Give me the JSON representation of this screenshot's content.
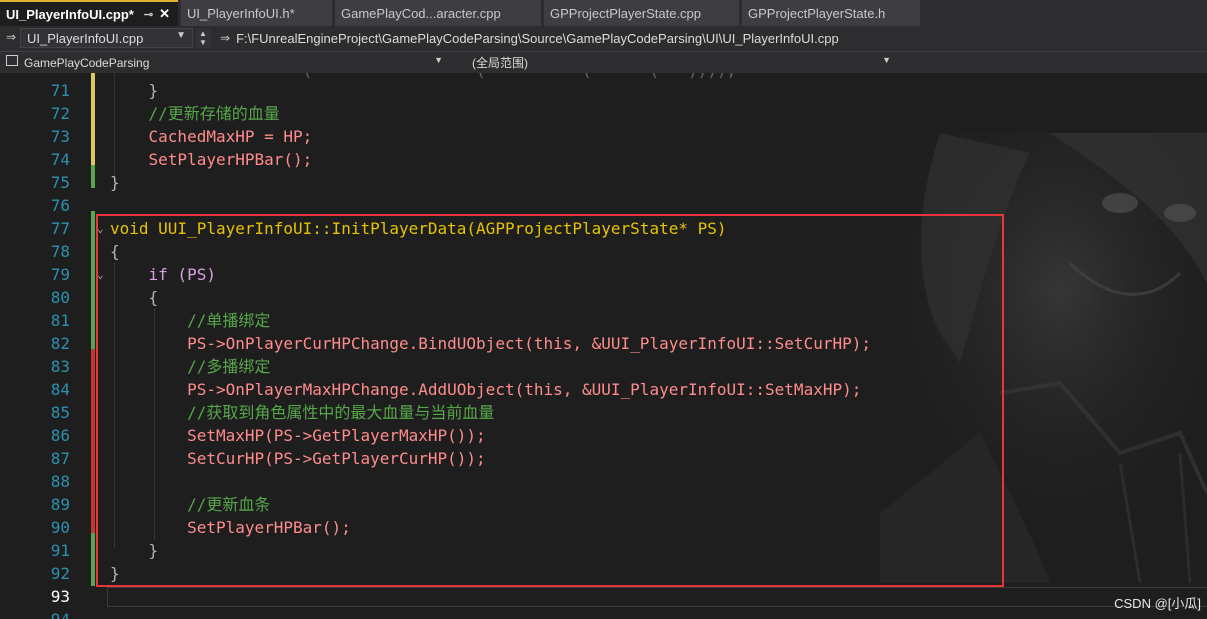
{
  "tabs": [
    {
      "label": "UI_PlayerInfoUI.cpp*",
      "active": true,
      "pin": "⊸",
      "close": "✕"
    },
    {
      "label": "UI_PlayerInfoUI.h*"
    },
    {
      "label": "GamePlayCod...aracter.cpp"
    },
    {
      "label": "GPProjectPlayerState.cpp"
    },
    {
      "label": "GPProjectPlayerState.h"
    }
  ],
  "nav": {
    "file_combo": "UI_PlayerInfoUI.cpp",
    "path": "F:\\FUnrealEngineProject\\GamePlayCodeParsing\\Source\\GamePlayCodeParsing\\UI\\UI_PlayerInfoUI.cpp",
    "project_combo": "GamePlayCodeParsing",
    "scope_combo": "(全局范围)"
  },
  "code_lines": [
    {
      "n": "71",
      "text": "    }"
    },
    {
      "n": "72",
      "text": "    //更新存储的血量"
    },
    {
      "n": "73",
      "text": "    CachedMaxHP = HP;"
    },
    {
      "n": "74",
      "text": "    SetPlayerHPBar();"
    },
    {
      "n": "75",
      "text": "}"
    },
    {
      "n": "76",
      "text": ""
    },
    {
      "n": "77",
      "text": "void UUI_PlayerInfoUI::InitPlayerData(AGPProjectPlayerState* PS)"
    },
    {
      "n": "78",
      "text": "{"
    },
    {
      "n": "79",
      "text": "    if (PS)"
    },
    {
      "n": "80",
      "text": "    {"
    },
    {
      "n": "81",
      "text": "        //单播绑定"
    },
    {
      "n": "82",
      "text": "        PS->OnPlayerCurHPChange.BindUObject(this, &UUI_PlayerInfoUI::SetCurHP);"
    },
    {
      "n": "83",
      "text": "        //多播绑定"
    },
    {
      "n": "84",
      "text": "        PS->OnPlayerMaxHPChange.AddUObject(this, &UUI_PlayerInfoUI::SetMaxHP);"
    },
    {
      "n": "85",
      "text": "        //获取到角色属性中的最大血量与当前血量"
    },
    {
      "n": "86",
      "text": "        SetMaxHP(PS->GetPlayerMaxHP());"
    },
    {
      "n": "87",
      "text": "        SetCurHP(PS->GetPlayerCurHP());"
    },
    {
      "n": "88",
      "text": ""
    },
    {
      "n": "89",
      "text": "        //更新血条"
    },
    {
      "n": "90",
      "text": "        SetPlayerHPBar();"
    },
    {
      "n": "91",
      "text": "    }"
    },
    {
      "n": "92",
      "text": "}"
    },
    {
      "n": "93",
      "text": ""
    },
    {
      "n": "94",
      "text": ""
    }
  ],
  "watermark": "CSDN @[小瓜]",
  "colors": {
    "highlight_box": "#e8343a",
    "active_tab_accent": "#dfb42e"
  }
}
